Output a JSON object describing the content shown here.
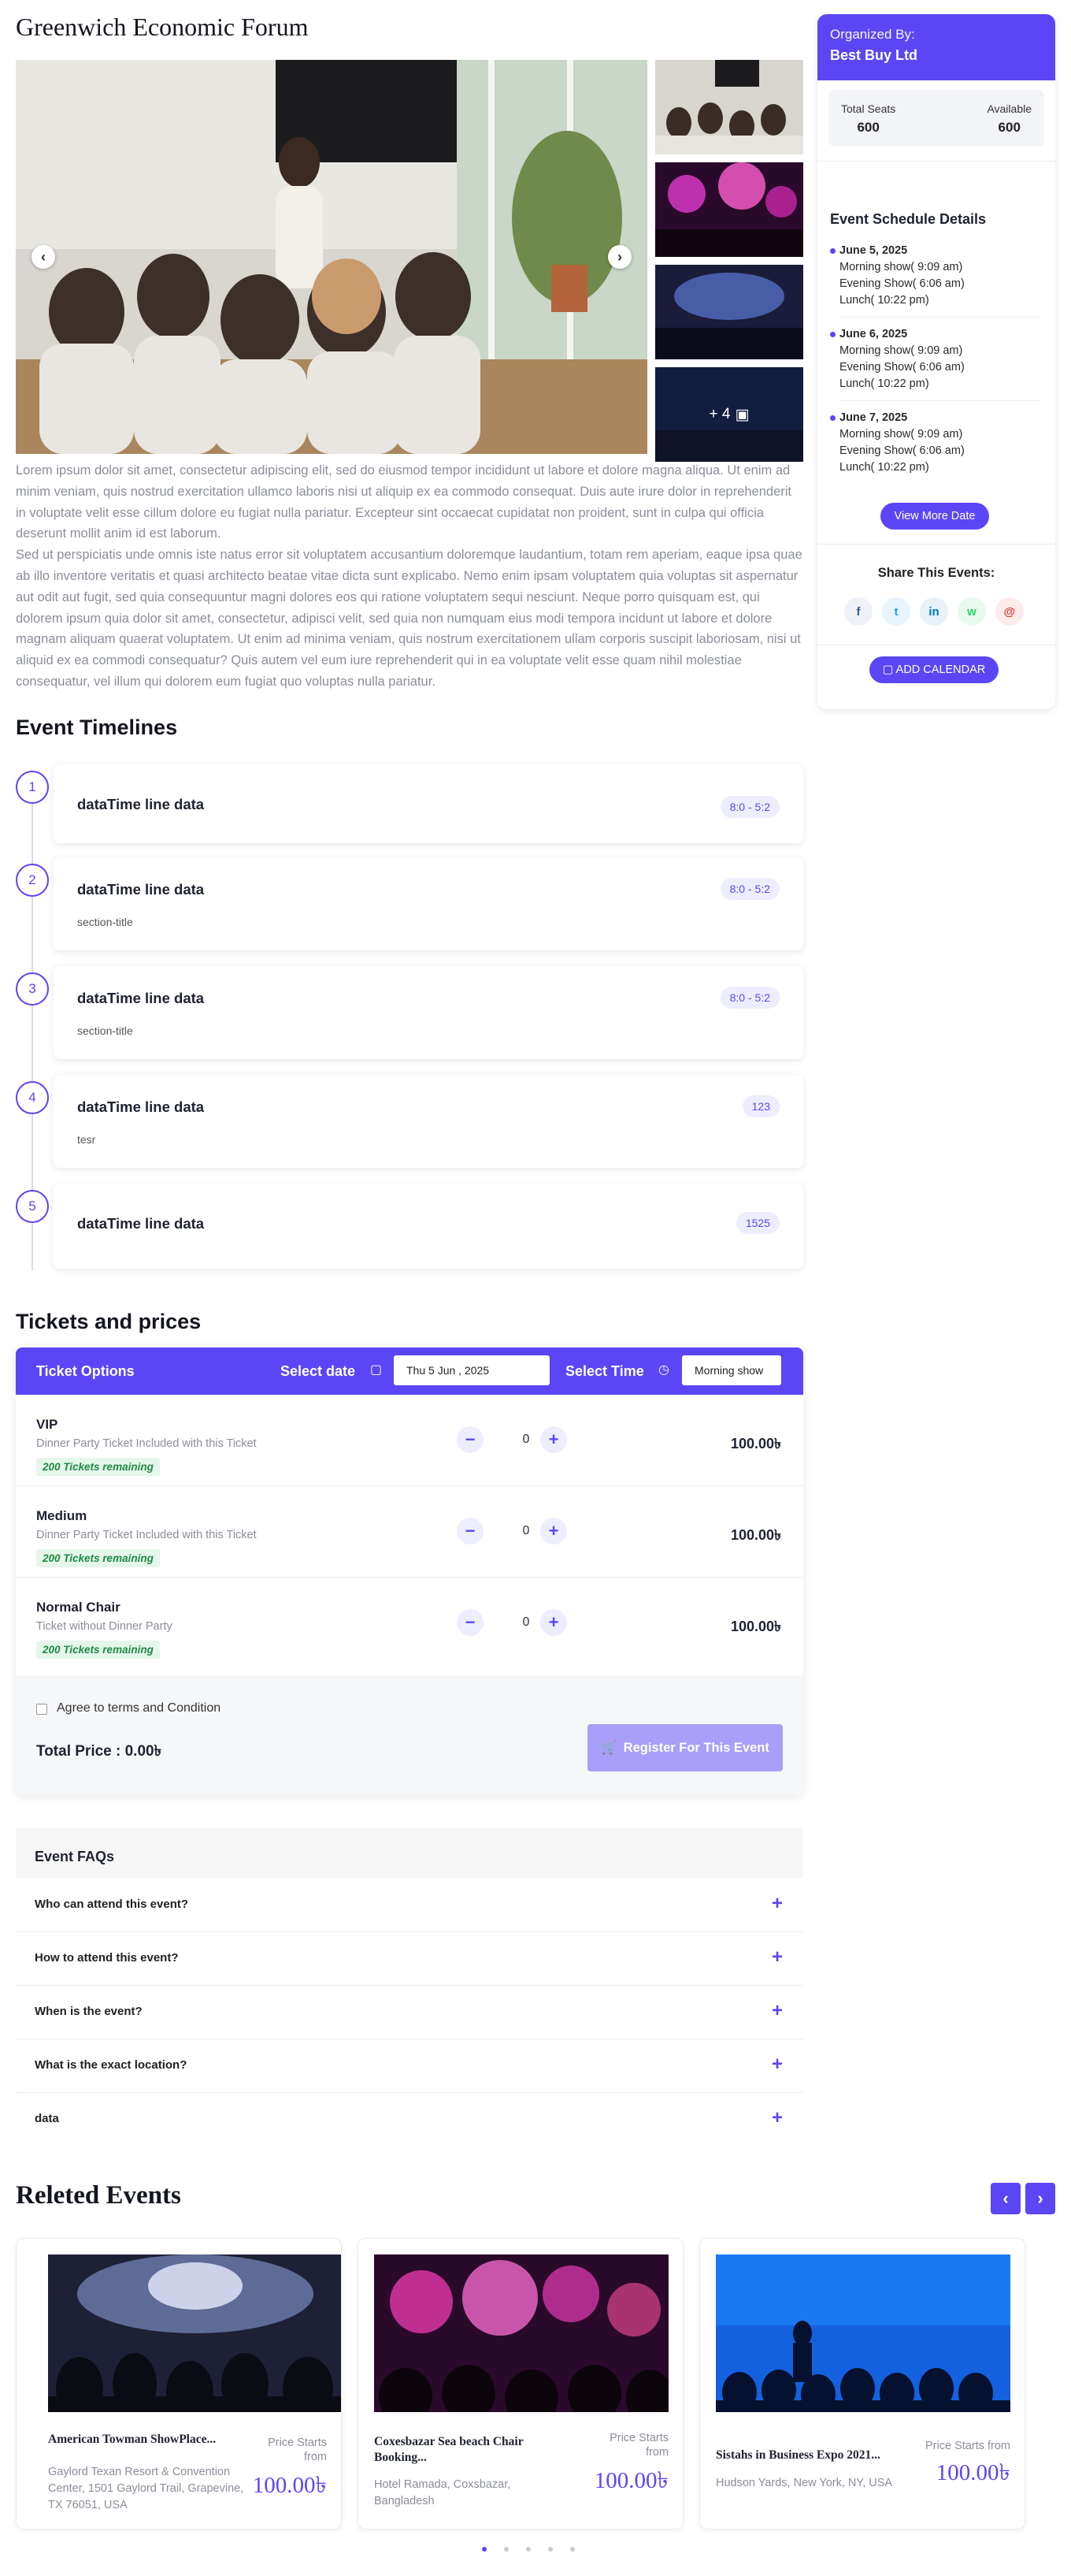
{
  "event": {
    "title": "Greenwich Economic Forum",
    "more_photos": "+ 4",
    "description": [
      "Lorem ipsum dolor sit amet, consectetur adipiscing elit, sed do eiusmod tempor incididunt ut labore et dolore magna aliqua. Ut enim ad minim veniam, quis nostrud exercitation ullamco laboris nisi ut aliquip ex ea commodo consequat. Duis aute irure dolor in reprehenderit in voluptate velit esse cillum dolore eu fugiat nulla pariatur. Excepteur sint occaecat cupidatat non proident, sunt in culpa qui officia deserunt mollit anim id est laborum.",
      "Sed ut perspiciatis unde omnis iste natus error sit voluptatem accusantium doloremque laudantium, totam rem aperiam, eaque ipsa quae ab illo inventore veritatis et quasi architecto beatae vitae dicta sunt explicabo. Nemo enim ipsam voluptatem quia voluptas sit aspernatur aut odit aut fugit, sed quia consequuntur magni dolores eos qui ratione voluptatem sequi nesciunt. Neque porro quisquam est, qui dolorem ipsum quia dolor sit amet, consectetur, adipisci velit, sed quia non numquam eius modi tempora incidunt ut labore et dolore magnam aliquam quaerat voluptatem. Ut enim ad minima veniam, quis nostrum exercitationem ullam corporis suscipit laboriosam, nisi ut aliquid ex ea commodi consequatur? Quis autem vel eum iure reprehenderit qui in ea voluptate velit esse quam nihil molestiae consequatur, vel illum qui dolorem eum fugiat quo voluptas nulla pariatur."
    ]
  },
  "sidebar": {
    "organized_label": "Organized By:",
    "organizer": "Best Buy Ltd",
    "total_seats_label": "Total Seats",
    "total_seats": "600",
    "available_label": "Available",
    "available": "600",
    "schedule_title": "Event Schedule Details",
    "days": [
      {
        "date": "June 5, 2025",
        "lines": [
          "Morning show( 9:09 am)",
          "Evening Show( 6:06 am)",
          "Lunch( 10:22 pm)"
        ]
      },
      {
        "date": "June 6, 2025",
        "lines": [
          "Morning show( 9:09 am)",
          "Evening Show( 6:06 am)",
          "Lunch( 10:22 pm)"
        ]
      },
      {
        "date": "June 7, 2025",
        "lines": [
          "Morning show( 9:09 am)",
          "Evening Show( 6:06 am)",
          "Lunch( 10:22 pm)"
        ]
      }
    ],
    "view_more": "View More Date",
    "share_title": "Share This Events:",
    "add_calendar": "ADD CALENDAR",
    "share_icons": [
      {
        "name": "facebook-icon",
        "glyph": "f",
        "color": "#3b5998",
        "bg": "#eef1f8"
      },
      {
        "name": "twitter-icon",
        "glyph": "t",
        "color": "#1da1f2",
        "bg": "#e9f5fe"
      },
      {
        "name": "linkedin-icon",
        "glyph": "in",
        "color": "#0077b5",
        "bg": "#e6f1f8"
      },
      {
        "name": "whatsapp-icon",
        "glyph": "w",
        "color": "#25d366",
        "bg": "#e8f9ee"
      },
      {
        "name": "email-icon",
        "glyph": "@",
        "color": "#e0362c",
        "bg": "#fcebea"
      }
    ]
  },
  "timeline": {
    "title": "Event Timelines",
    "items": [
      {
        "num": "1",
        "title": "dataTime line data",
        "sub": "",
        "badge": "8:0 - 5:2"
      },
      {
        "num": "2",
        "title": "dataTime line data",
        "sub": "section-title",
        "badge": "8:0 - 5:2"
      },
      {
        "num": "3",
        "title": "dataTime line data",
        "sub": "section-title",
        "badge": "8:0 - 5:2"
      },
      {
        "num": "4",
        "title": "dataTime line data",
        "sub": "tesr",
        "badge": "123"
      },
      {
        "num": "5",
        "title": "dataTime line data",
        "sub": "",
        "badge": "1525"
      }
    ]
  },
  "tickets": {
    "title": "Tickets and prices",
    "options_label": "Ticket Options",
    "select_date_label": "Select date",
    "date_value": "Thu 5 Jun , 2025",
    "select_time_label": "Select Time",
    "time_value": "Morning show",
    "rows": [
      {
        "name": "VIP",
        "desc": "Dinner Party Ticket Included with this Ticket",
        "remaining": "200 Tickets remaining",
        "qty": "0",
        "price": "100.00৳"
      },
      {
        "name": "Medium",
        "desc": "Dinner Party Ticket Included with this Ticket",
        "remaining": "200 Tickets remaining",
        "qty": "0",
        "price": "100.00৳"
      },
      {
        "name": "Normal Chair",
        "desc": "Ticket without Dinner Party",
        "remaining": "200 Tickets remaining",
        "qty": "0",
        "price": "100.00৳"
      }
    ],
    "terms": "Agree to terms and Condition",
    "total": "Total Price : 0.00৳",
    "register": "Register For This Event"
  },
  "faqs": {
    "title": "Event FAQs",
    "items": [
      "Who can attend this event?",
      "How to attend this event?",
      "When is the event?",
      "What is the exact location?",
      "data"
    ]
  },
  "related": {
    "title": "Releted Events",
    "cards": [
      {
        "name": "American Towman ShowPlace...",
        "location": "Gaylord Texan Resort & Convention Center, 1501 Gaylord Trail, Grapevine, TX 76051, USA",
        "price_label": "Price Starts from",
        "price": "100.00৳"
      },
      {
        "name": "Coxesbazar Sea beach Chair Booking...",
        "location": "Hotel Ramada, Coxsbazar, Bangladesh",
        "price_label": "Price Starts from",
        "price": "100.00৳"
      },
      {
        "name": "Sistahs in Business Expo 2021...",
        "location": "Hudson Yards, New York, NY, USA",
        "price_label": "Price Starts from",
        "price": "100.00৳"
      }
    ]
  },
  "colors": {
    "accent": "#5b46f5",
    "accent_light": "#eeedfd",
    "success": "#218a45"
  }
}
